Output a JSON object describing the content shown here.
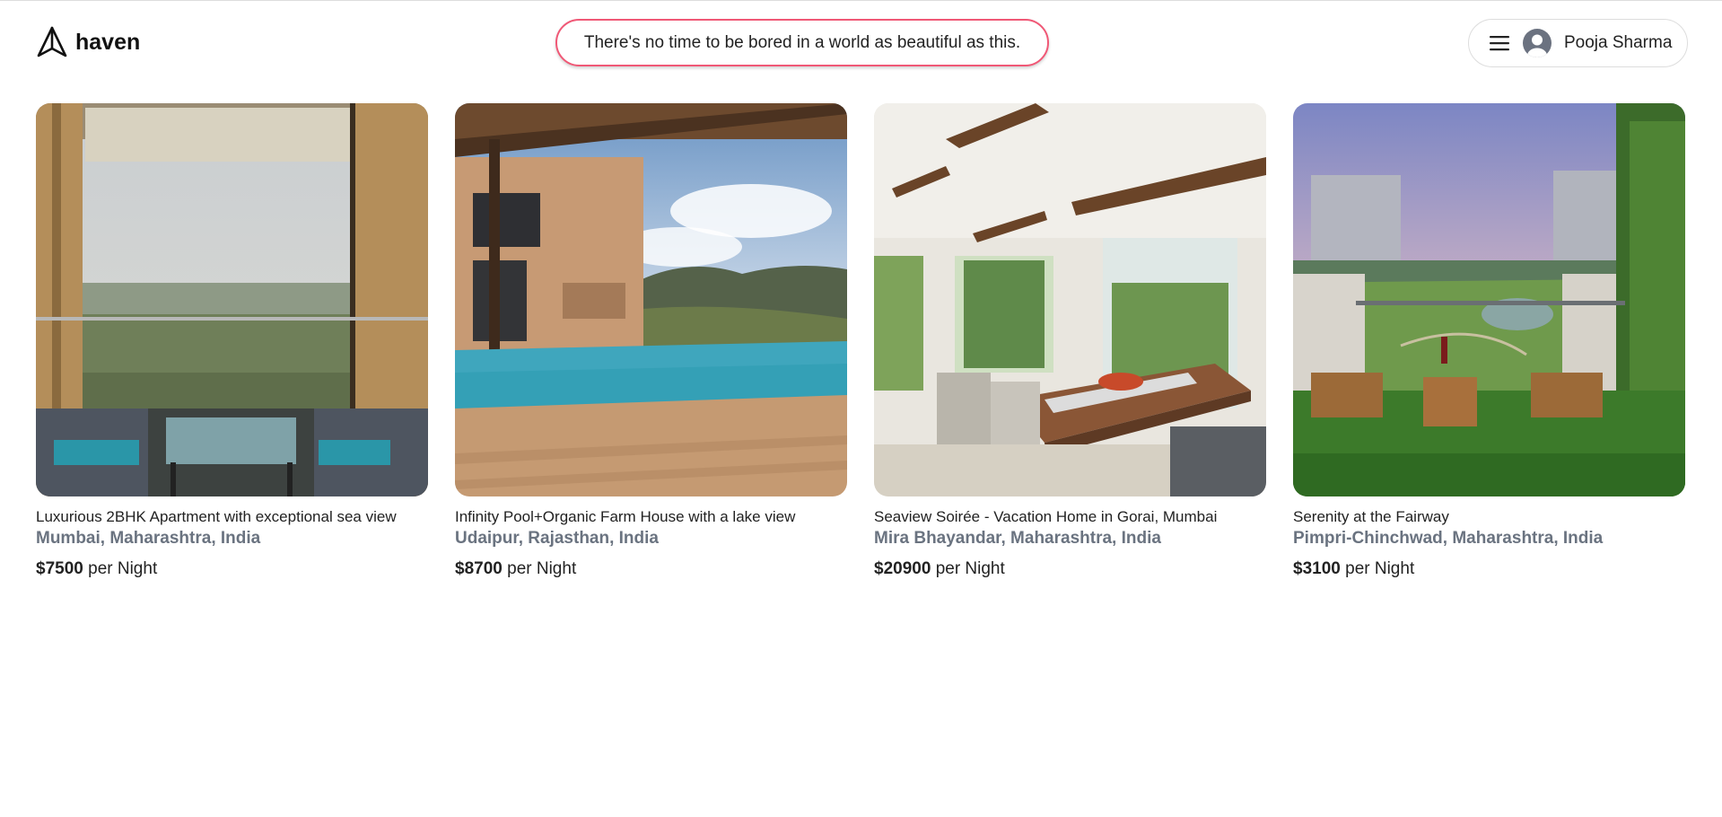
{
  "header": {
    "brand": "haven",
    "tagline": "There's no time to be bored in a world as beautiful as this.",
    "user_name": "Pooja Sharma",
    "icons": {
      "logo": "paper-plane-icon",
      "menu": "hamburger-menu-icon",
      "avatar": "user-avatar-icon"
    },
    "colors": {
      "tagline_border": "#f05876"
    }
  },
  "listings": [
    {
      "title": "Luxurious 2BHK Apartment with exceptional sea view",
      "location": "Mumbai, Maharashtra, India",
      "price": "$7500",
      "price_suffix": "per Night"
    },
    {
      "title": "Infinity Pool+Organic Farm House with a lake view",
      "location": "Udaipur, Rajasthan, India",
      "price": "$8700",
      "price_suffix": "per Night"
    },
    {
      "title": "Seaview Soirée - Vacation Home in Gorai, Mumbai",
      "location": "Mira Bhayandar, Maharashtra, India",
      "price": "$20900",
      "price_suffix": "per Night"
    },
    {
      "title": "Serenity at the Fairway",
      "location": "Pimpri-Chinchwad, Maharashtra, India",
      "price": "$3100",
      "price_suffix": "per Night"
    }
  ],
  "colors": {
    "location_text": "#6a7380",
    "body_text": "#222222"
  }
}
